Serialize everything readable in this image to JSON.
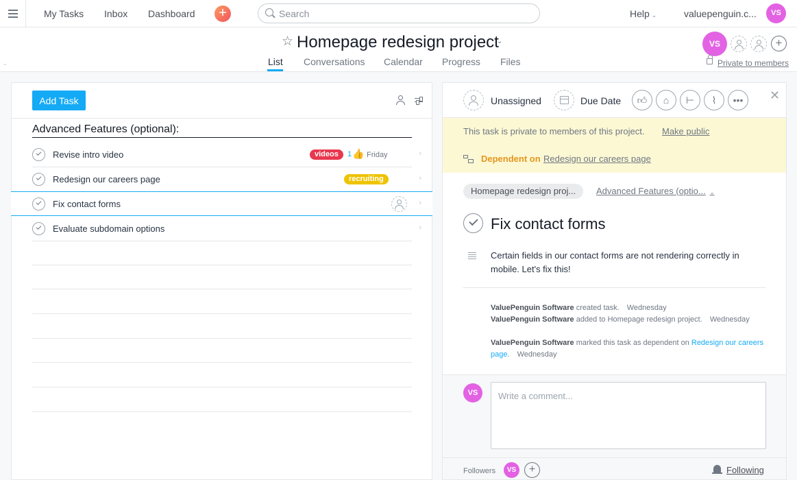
{
  "topbar": {
    "nav": [
      "My Tasks",
      "Inbox",
      "Dashboard"
    ],
    "search_placeholder": "Search",
    "help": "Help",
    "org": "valuepenguin.c...",
    "user_initials": "VS"
  },
  "project": {
    "title": "Homepage redesign project",
    "tabs": [
      "List",
      "Conversations",
      "Calendar",
      "Progress",
      "Files"
    ],
    "active_tab": "List",
    "owner_initials": "VS",
    "privacy": "Private to members"
  },
  "list": {
    "add_task": "Add Task",
    "section": "Advanced Features (optional):",
    "tasks": [
      {
        "name": "Revise intro video",
        "tag": "videos",
        "likes": "1",
        "due": "Friday"
      },
      {
        "name": "Redesign our careers page",
        "tag": "recruiting"
      },
      {
        "name": "Fix contact forms"
      },
      {
        "name": "Evaluate subdomain options"
      }
    ]
  },
  "detail": {
    "assignee": "Unassigned",
    "due_date": "Due Date",
    "privacy_notice": "This task is private to members of this project.",
    "make_public": "Make public",
    "dependent_label": "Dependent on",
    "dependent_task": "Redesign our careers page",
    "project_pill": "Homepage redesign proj...",
    "section": "Advanced Features (optio...",
    "task_title": "Fix contact forms",
    "description": "Certain fields in our contact forms are not rendering correctly in mobile. Let's fix this!",
    "activity": [
      {
        "actor": "ValuePenguin Software",
        "action": "created task.",
        "when": "Wednesday"
      },
      {
        "actor": "ValuePenguin Software",
        "action": "added to Homepage redesign project.",
        "when": "Wednesday"
      },
      {
        "actor": "ValuePenguin Software",
        "action": "marked this task as dependent on",
        "link": "Redesign our careers page",
        "when": "Wednesday"
      }
    ],
    "comment_placeholder": "Write a comment...",
    "commenter_initials": "VS",
    "followers_label": "Followers",
    "follower_initials": "VS",
    "following": "Following"
  },
  "colors": {
    "accent": "#14aaf5",
    "avatar": "#e362e3",
    "tag_videos": "#e8384f",
    "tag_recruiting": "#eec300",
    "dependent": "#e5961e",
    "banner": "#fcf8d4"
  }
}
